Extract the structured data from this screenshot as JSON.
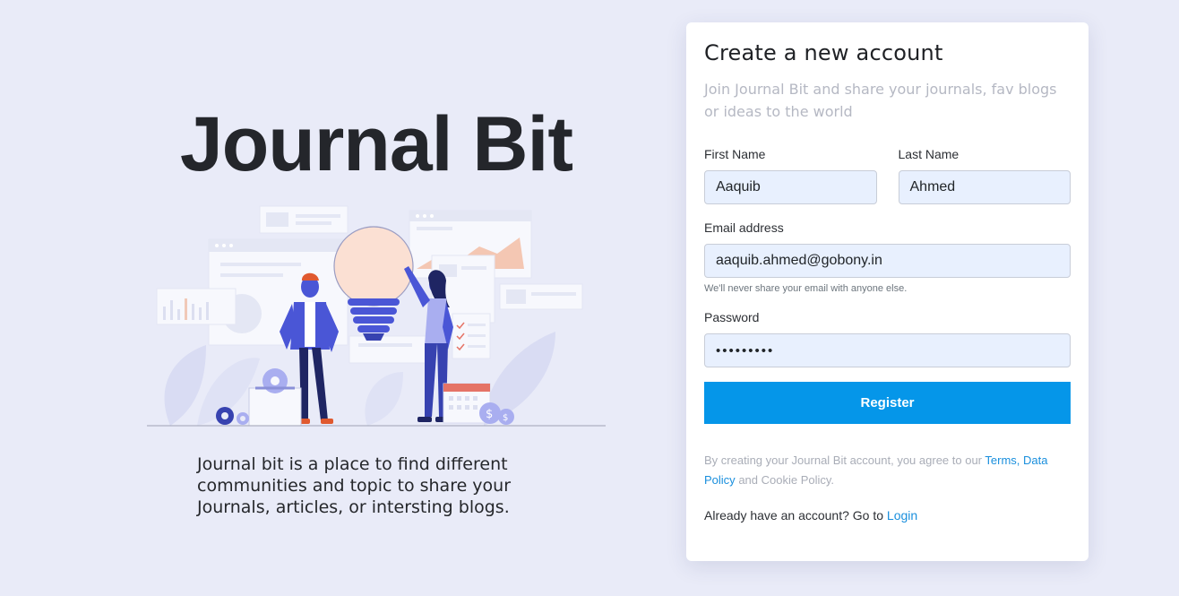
{
  "brand": {
    "title": "Journal Bit",
    "tagline": "Journal bit is a place to find different communities and topic to share your Journals, articles, or intersting blogs."
  },
  "form": {
    "heading": "Create a new account",
    "subtitle": "Join Journal Bit and share your journals, fav blogs or ideas to the world",
    "first_name": {
      "label": "First Name",
      "value": "Aaquib"
    },
    "last_name": {
      "label": "Last Name",
      "value": "Ahmed"
    },
    "email": {
      "label": "Email address",
      "value": "aaquib.ahmed@gobony.in",
      "help": "We'll never share your email with anyone else."
    },
    "password": {
      "label": "Password",
      "value": "•••••••••"
    },
    "register_label": "Register",
    "legal": {
      "prefix": "By creating your Journal Bit account, you agree to our",
      "terms": "Terms,",
      "data_policy": "Data Policy",
      "suffix": "and Cookie Policy."
    },
    "login": {
      "prefix": "Already have an account? Go to",
      "link": "Login"
    }
  },
  "colors": {
    "background": "#e9ebf8",
    "accent": "#0596e9",
    "link": "#1a8fdd",
    "illustration_primary": "#4a56d6"
  },
  "illustration": {
    "icons": [
      "laptop-icon",
      "lightbulb-icon",
      "gear-icon",
      "calendar-icon",
      "coin-icon",
      "person-icon"
    ]
  }
}
